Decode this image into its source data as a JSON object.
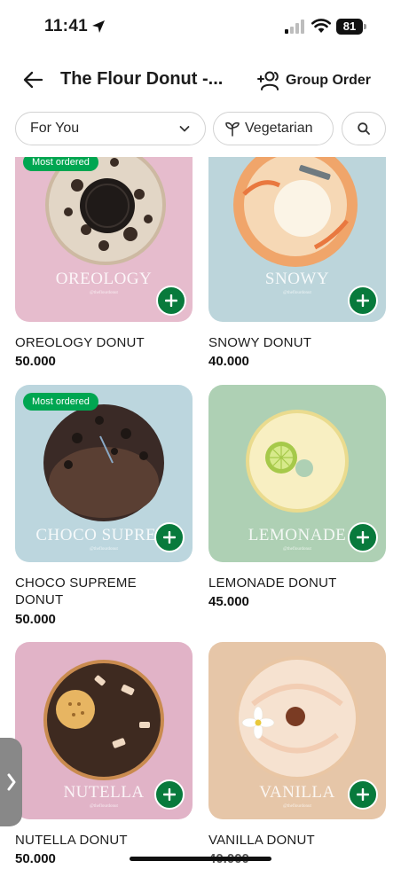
{
  "status_bar": {
    "time": "11:41",
    "battery": "81"
  },
  "header": {
    "title": "The Flour Donut -...",
    "group_order_label": "Group Order"
  },
  "filters": {
    "for_you_label": "For You",
    "vegetarian_label": "Vegetarian"
  },
  "colors": {
    "accent_green": "#087a3c",
    "badge_green": "#00a651"
  },
  "products": [
    {
      "name": "OREOLOGY DONUT",
      "price": "50.000",
      "badge": "Most ordered",
      "brand": "OREOLOGY",
      "brand_sub": "@theflourdonut",
      "bg": "#e6bccd"
    },
    {
      "name": "SNOWY DONUT",
      "price": "40.000",
      "badge": "",
      "brand": "SNOWY",
      "brand_sub": "@theflourdonut",
      "bg": "#bcd5db"
    },
    {
      "name": "CHOCO SUPREME DONUT",
      "price": "50.000",
      "badge": "Most ordered",
      "brand": "CHOCO SUPREM",
      "brand_sub": "@theflourdonut",
      "bg": "#bcd6de"
    },
    {
      "name": "LEMONADE DONUT",
      "price": "45.000",
      "badge": "",
      "brand": "LEMONADE",
      "brand_sub": "@theflourdonut",
      "bg": "#aed0b4"
    },
    {
      "name": "NUTELLA DONUT",
      "price": "50.000",
      "badge": "",
      "brand": "NUTELLA",
      "brand_sub": "@theflourdonut",
      "bg": "#e1b3c7"
    },
    {
      "name": "VANILLA DONUT",
      "price": "40.000",
      "badge": "",
      "brand": "VANILLA",
      "brand_sub": "@theflourdonut",
      "bg": "#e6c6a8"
    }
  ]
}
